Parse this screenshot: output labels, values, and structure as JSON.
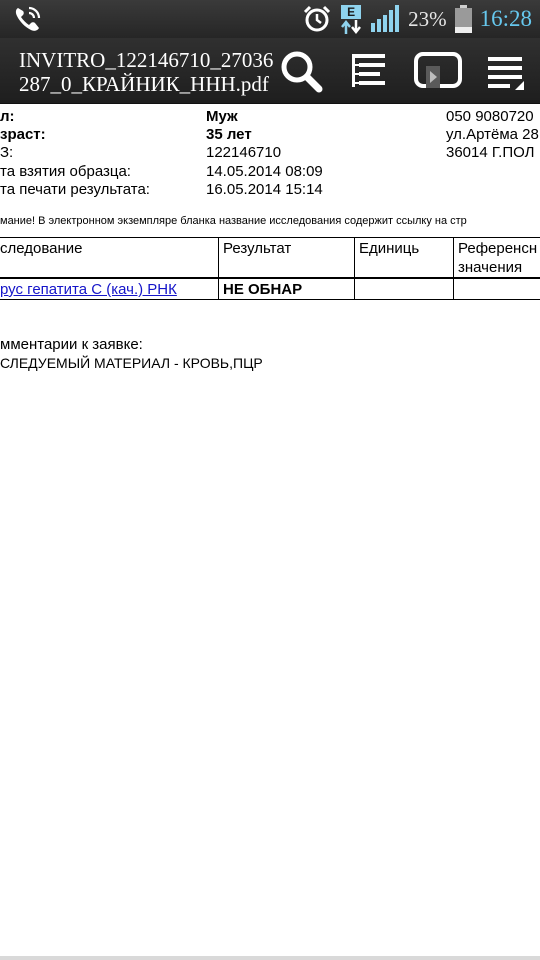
{
  "status_bar": {
    "battery_percent": "23%",
    "time": "16:28",
    "network_type": "E",
    "icons": [
      "phone-call-icon",
      "alarm-clock-icon",
      "data-arrows-icon",
      "signal-bars-icon",
      "battery-icon"
    ],
    "battery_level": 0.23
  },
  "toolbar": {
    "title": "INVITRO_122146710_27036287_0_КРАЙНИК_ННН.pdf",
    "icons": [
      "search-icon",
      "outline-icon",
      "reflow-icon",
      "menu-icon"
    ]
  },
  "document": {
    "fields": [
      {
        "label": "л:",
        "value": "Муж",
        "bold": true
      },
      {
        "label": "зраст:",
        "value": "35 лет",
        "bold": true
      },
      {
        "label": "З:",
        "value": "122146710",
        "bold": false
      },
      {
        "label": "та взятия образца:",
        "value": "14.05.2014 08:09",
        "bold": false
      },
      {
        "label": "та печати результата:",
        "value": "16.05.2014 15:14",
        "bold": false
      }
    ],
    "contacts": [
      "050 9080720",
      "ул.Артёма 28",
      "36014 Г.ПОЛ"
    ],
    "notice": "мание! В электронном экземпляре бланка название исследования содержит ссылку на стр",
    "table": {
      "headers": [
        "следование",
        "Результат",
        "Единиць",
        "Референсн",
        "значения"
      ],
      "row": {
        "test": "рус гепатита С (кач.) РНК",
        "result": "НЕ ОБНАР"
      }
    },
    "comments_label": "мментарии к заявке:",
    "comments_text": "СЛЕДУЕМЫЙ МАТЕРИАЛ - КРОВЬ,ПЦР"
  },
  "colors": {
    "accent_time": "#66c8ee",
    "link": "#1515c9",
    "toolbar": "#262626"
  }
}
